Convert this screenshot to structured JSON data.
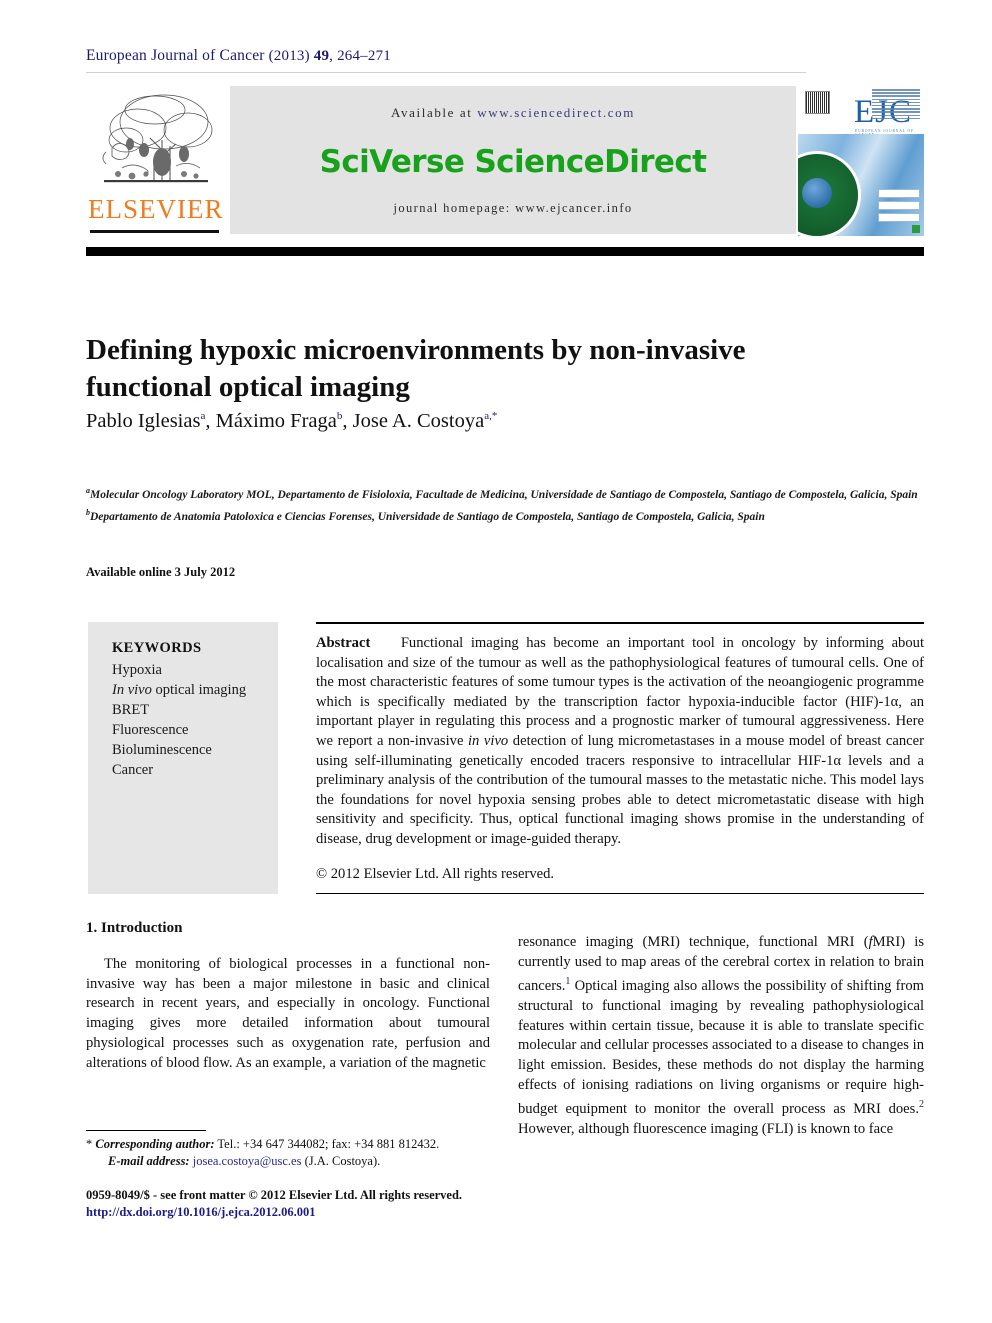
{
  "running_head": {
    "journal": "European Journal of Cancer",
    "year": "(2013)",
    "volume": "49",
    "pages": ", 264–271"
  },
  "masthead": {
    "publisher_logo_text": "ELSEVIER",
    "available_prefix": "Available at ",
    "available_url": "www.sciencedirect.com",
    "platform_title": "SciVerse ScienceDirect",
    "homepage_line": "journal homepage: www.ejcancer.info",
    "cover_logo": "EJC",
    "cover_logo_subtitle": "EUROPEAN JOURNAL OF CANCER"
  },
  "article": {
    "title": "Defining hypoxic microenvironments by non-invasive functional optical imaging",
    "authors": [
      {
        "name": "Pablo Iglesias",
        "marks": "a",
        "sep": ", "
      },
      {
        "name": "Máximo Fraga",
        "marks": "b",
        "sep": ", "
      },
      {
        "name": "Jose A. Costoya",
        "marks": "a,*",
        "sep": ""
      }
    ],
    "affiliations": [
      {
        "mark": "a",
        "text": "Molecular Oncology Laboratory MOL, Departamento de Fisioloxia, Facultade de Medicina, Universidade de Santiago de Compostela, Santiago de Compostela, Galicia, Spain"
      },
      {
        "mark": "b",
        "text": "Departamento de Anatomia Patoloxica e Ciencias Forenses, Universidade de Santiago de Compostela, Santiago de Compostela, Galicia, Spain"
      }
    ],
    "available_online": "Available online 3 July 2012"
  },
  "keywords": {
    "heading": "KEYWORDS",
    "items": [
      {
        "text": "Hypoxia",
        "italic_prefix": ""
      },
      {
        "text": " optical imaging",
        "italic_prefix": "In vivo"
      },
      {
        "text": "BRET",
        "italic_prefix": ""
      },
      {
        "text": "Fluorescence",
        "italic_prefix": ""
      },
      {
        "text": "Bioluminescence",
        "italic_prefix": ""
      },
      {
        "text": "Cancer",
        "italic_prefix": ""
      }
    ]
  },
  "abstract": {
    "label": "Abstract",
    "part1": "Functional imaging has become an important tool in oncology by informing about localisation and size of the tumour as well as the pathophysiological features of tumoural cells. One of the most characteristic features of some tumour types is the activation of the neoangiogenic programme which is specifically mediated by the transcription factor hypoxia-inducible factor (HIF)-1α, an important player in regulating this process and a prognostic marker of tumoural aggressiveness. Here we report a non-invasive ",
    "italic1": "in vivo",
    "part2": " detection of lung micrometastases in a mouse model of breast cancer using self-illuminating genetically encoded tracers responsive to intracellular HIF-1α levels and a preliminary analysis of the contribution of the tumoural masses to the metastatic niche. This model lays the foundations for novel hypoxia sensing probes able to detect micrometastatic disease with high sensitivity and specificity. Thus, optical functional imaging shows promise in the understanding of disease, drug development or image-guided therapy.",
    "copyright": "© 2012 Elsevier Ltd. All rights reserved."
  },
  "body": {
    "section_heading": "1. Introduction",
    "left_column": "The monitoring of biological processes in a functional non-invasive way has been a major milestone in basic and clinical research in recent years, and especially in oncology. Functional imaging gives more detailed information about tumoural physiological processes such as oxygenation rate, perfusion and alterations of blood flow. As an example, a variation of the magnetic",
    "right_column_part1": "resonance imaging (MRI) technique, functional MRI (",
    "right_column_italic_f": "f",
    "right_column_part2": "MRI) is currently used to map areas of the cerebral cortex in relation to brain cancers.",
    "right_column_ref1": "1",
    "right_column_part3": " Optical imaging also allows the possibility of shifting from structural to functional imaging by revealing pathophysiological features within certain tissue, because it is able to translate specific molecular and cellular processes associated to a disease to changes in light emission. Besides, these methods do not display the harming effects of ionising radiations on living organisms or require high-budget equipment to monitor the overall process as MRI does.",
    "right_column_ref2": "2",
    "right_column_part4": " However, although fluorescence imaging (FLI) is known to face"
  },
  "footnote": {
    "star": "*",
    "corresponding_label": "Corresponding author:",
    "corresponding_text": " Tel.: +34 647 344082; fax: +34 881 812432.",
    "email_label": "E-mail address:",
    "email": "josea.costoya@usc.es",
    "email_suffix": " (J.A. Costoya)."
  },
  "footer": {
    "front_matter": "0959-8049/$ - see front matter © 2012 Elsevier Ltd. All rights reserved.",
    "doi": "http://dx.doi.org/10.1016/j.ejca.2012.06.001"
  },
  "colors": {
    "sciencedirect_green": "#18a11a",
    "elsevier_orange": "#f07c1e",
    "link_blue": "#1a1a8c",
    "band_grey": "#e3e3e3",
    "keyword_box_grey": "#e6e6e6"
  }
}
